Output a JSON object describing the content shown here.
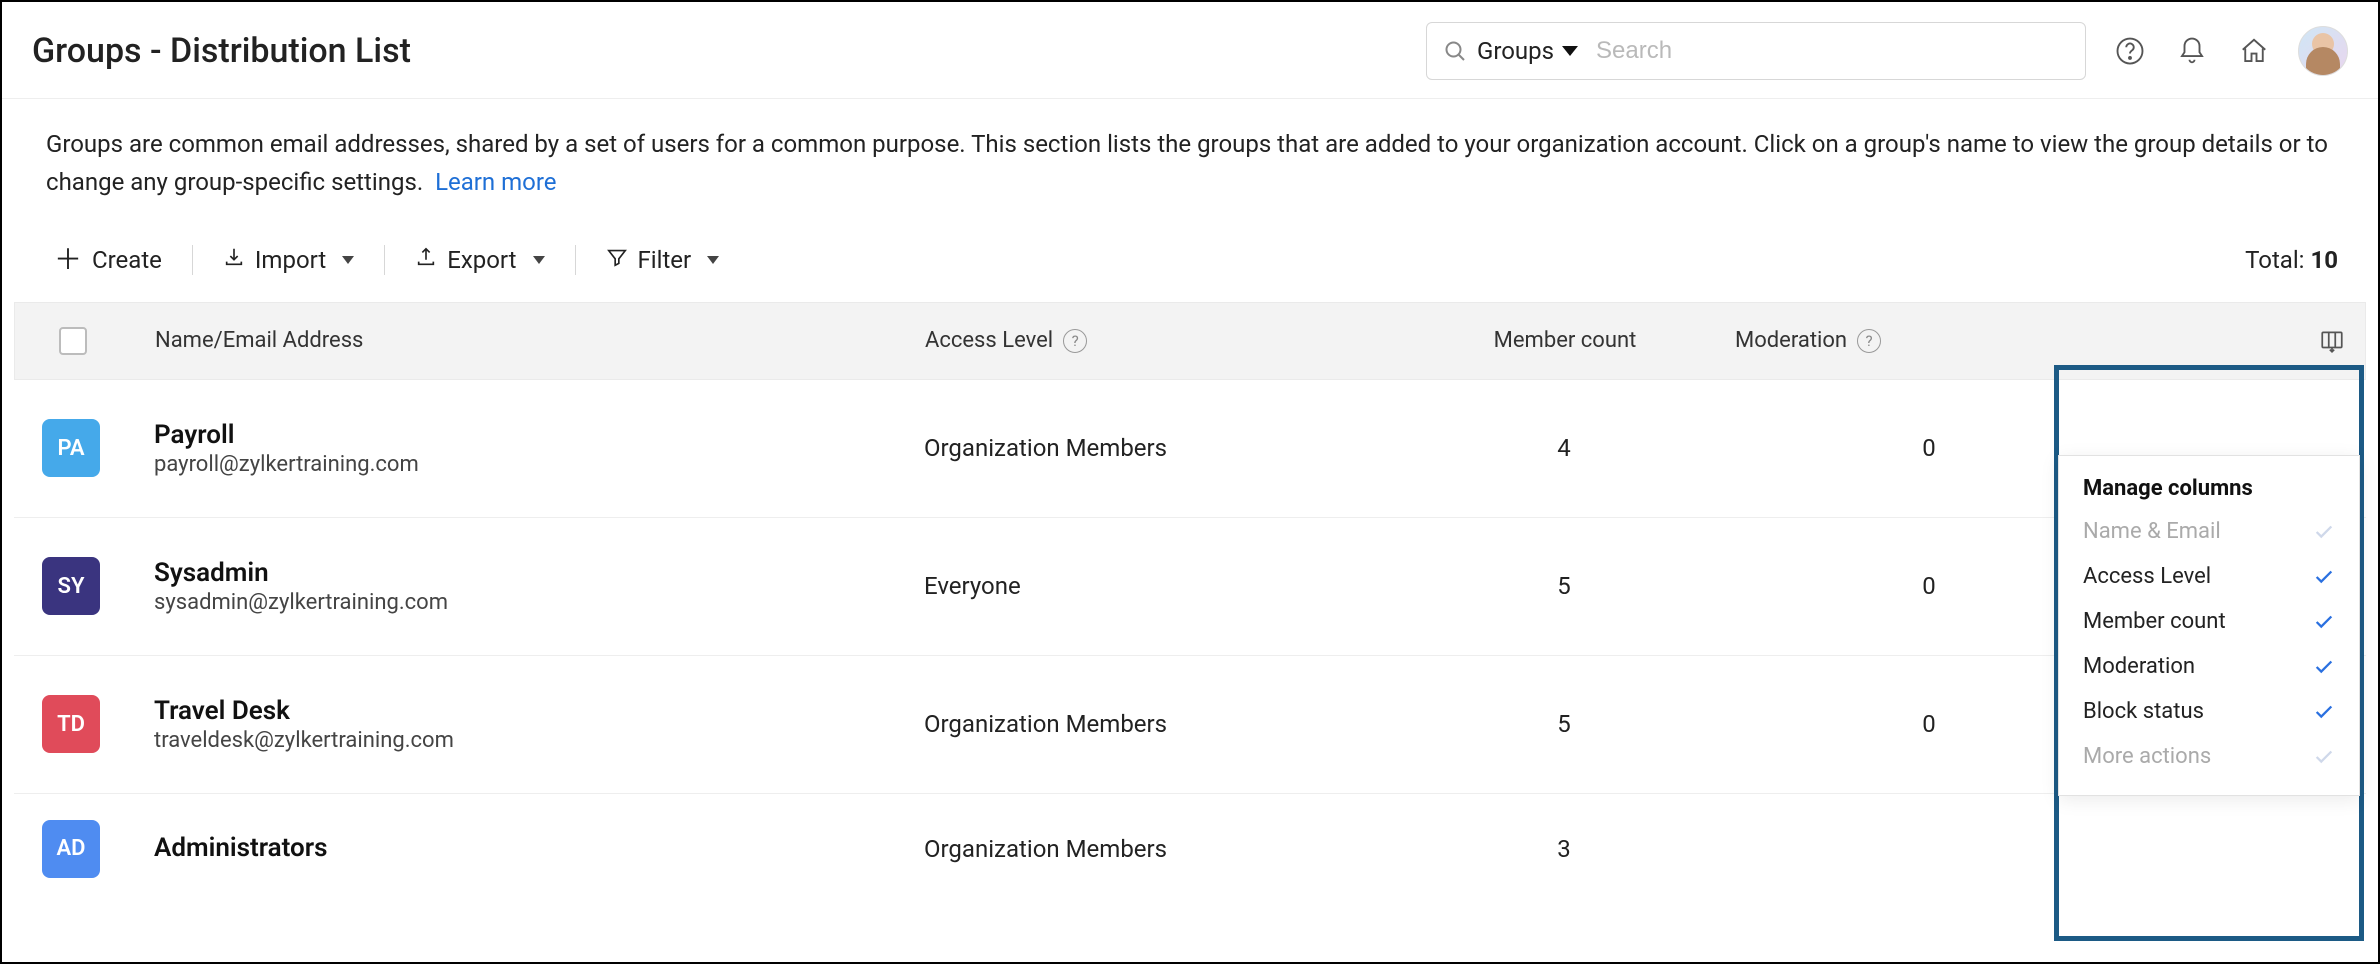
{
  "header": {
    "title": "Groups - Distribution List",
    "search_scope": "Groups",
    "search_placeholder": "Search"
  },
  "description": {
    "text": "Groups are common email addresses, shared by a set of users for a common purpose. This section lists the groups that are added to your organization account. Click on a group's name to view the group details or to change any group-specific settings.",
    "link_label": "Learn more"
  },
  "toolbar": {
    "create": "Create",
    "import": "Import",
    "export": "Export",
    "filter": "Filter",
    "total_label": "Total:",
    "total_value": "10"
  },
  "columns": {
    "name": "Name/Email Address",
    "access": "Access Level",
    "count": "Member count",
    "moderation": "Moderation"
  },
  "rows": [
    {
      "initials": "PA",
      "color": "#45a9ea",
      "name": "Payroll",
      "email": "payroll@zylkertraining.com",
      "access": "Organization Members",
      "count": "4",
      "moderation": "0"
    },
    {
      "initials": "SY",
      "color": "#3a347f",
      "name": "Sysadmin",
      "email": "sysadmin@zylkertraining.com",
      "access": "Everyone",
      "count": "5",
      "moderation": "0"
    },
    {
      "initials": "TD",
      "color": "#e04b5a",
      "name": "Travel Desk",
      "email": "traveldesk@zylkertraining.com",
      "access": "Organization Members",
      "count": "5",
      "moderation": "0"
    },
    {
      "initials": "AD",
      "color": "#4f8cf1",
      "name": "Administrators",
      "email": "",
      "access": "Organization Members",
      "count": "3",
      "moderation": ""
    }
  ],
  "popover": {
    "title": "Manage columns",
    "items": [
      {
        "label": "Name & Email",
        "enabled": false
      },
      {
        "label": "Access Level",
        "enabled": true
      },
      {
        "label": "Member count",
        "enabled": true
      },
      {
        "label": "Moderation",
        "enabled": true
      },
      {
        "label": "Block status",
        "enabled": true
      },
      {
        "label": "More actions",
        "enabled": false
      }
    ]
  }
}
